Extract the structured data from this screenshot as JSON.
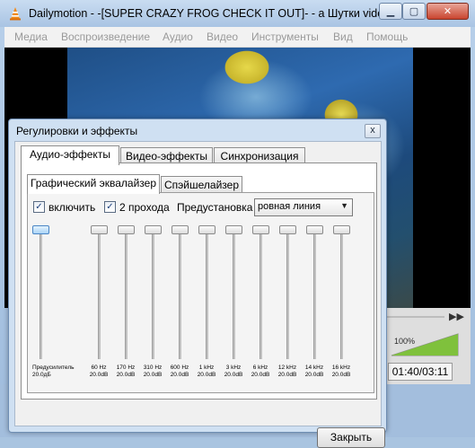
{
  "window": {
    "title": "Dailymotion - -[SUPER CRAZY FROG CHECK IT OUT]- - a Шутки video...",
    "minimize_glyph": "▁",
    "maximize_glyph": "▢",
    "close_glyph": "✕"
  },
  "menu": [
    "Медиа",
    "Воспроизведение",
    "Аудио",
    "Видео",
    "Инструменты",
    "Вид",
    "Помощь"
  ],
  "player": {
    "time": "01:40/03:11",
    "volume": "100%",
    "volume_level": 1.0,
    "skip_glyph": "▶▶"
  },
  "dialog": {
    "title": "Регулировки и эффекты",
    "close_glyph": "x",
    "tabs": [
      "Аудио-эффекты",
      "Видео-эффекты",
      "Синхронизация"
    ],
    "active_tab": 0,
    "subtabs": [
      "Графический эквалайзер",
      "Спэйшелайзер"
    ],
    "active_subtab": 0,
    "enable_label": "включить",
    "enable_checked": true,
    "two_pass_label": "2 прохода",
    "two_pass_checked": true,
    "preset_label": "Предустановка",
    "preset_value": "ровная линия",
    "preamp": {
      "label": "Предусилитель",
      "value": "20.0дБ",
      "level": 1.0
    },
    "bands": [
      {
        "freq": "60 Hz",
        "value": "20.0dB",
        "level": 1.0
      },
      {
        "freq": "170 Hz",
        "value": "20.0dB",
        "level": 1.0
      },
      {
        "freq": "310 Hz",
        "value": "20.0dB",
        "level": 1.0
      },
      {
        "freq": "600 Hz",
        "value": "20.0dB",
        "level": 1.0
      },
      {
        "freq": "1 kHz",
        "value": "20.0dB",
        "level": 1.0
      },
      {
        "freq": "3 kHz",
        "value": "20.0dB",
        "level": 1.0
      },
      {
        "freq": "6 kHz",
        "value": "20.0dB",
        "level": 1.0
      },
      {
        "freq": "12 kHz",
        "value": "20.0dB",
        "level": 1.0
      },
      {
        "freq": "14 kHz",
        "value": "20.0dB",
        "level": 1.0
      },
      {
        "freq": "16 kHz",
        "value": "20.0dB",
        "level": 1.0
      }
    ],
    "close_button": "Закрыть"
  }
}
